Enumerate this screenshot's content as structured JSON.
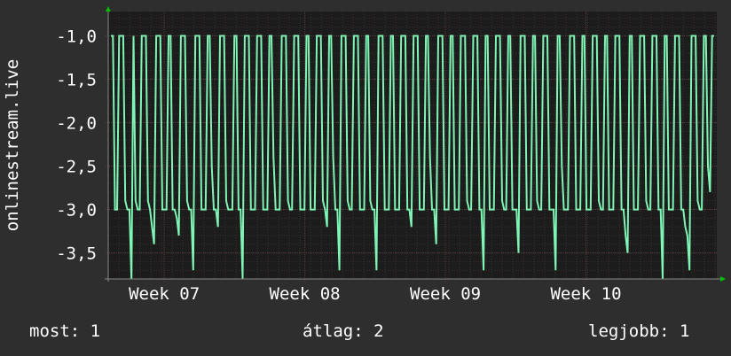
{
  "chart_data": {
    "type": "line",
    "ylabel": "onlinestream.live",
    "yticks": [
      "-1,0",
      "-1,5",
      "-2,0",
      "-2,5",
      "-3,0",
      "-3,5"
    ],
    "ytick_values": [
      -1.0,
      -1.5,
      -2.0,
      -2.5,
      -3.0,
      -3.5
    ],
    "ylim": [
      -3.8,
      -0.72
    ],
    "xlim": [
      0,
      1
    ],
    "xticks": [
      {
        "label": "Week 07",
        "pos": 0.092
      },
      {
        "label": "Week 08",
        "pos": 0.323
      },
      {
        "label": "Week 09",
        "pos": 0.554
      },
      {
        "label": "Week 10",
        "pos": 0.785
      }
    ],
    "grid": true,
    "colors": {
      "background": "#2e2e2e",
      "plot": "#1c1c1c",
      "grid": "#5a3a3a",
      "line": "#7ff5b5",
      "axis_arrow": "#00c000"
    },
    "series": [
      {
        "values": [
          -1.0,
          -1.0,
          -3.0,
          -3.0,
          -1.0,
          -1.0,
          -1.0,
          -2.9,
          -3.0,
          -3.0,
          -3.8,
          -1.0,
          -2.9,
          -3.0,
          -3.0,
          -1.0,
          -1.0,
          -1.0,
          -2.9,
          -3.0,
          -3.2,
          -3.4,
          -1.0,
          -1.0,
          -1.0,
          -3.0,
          -3.0,
          -3.0,
          -1.0,
          -1.0,
          -3.0,
          -3.0,
          -3.1,
          -3.3,
          -1.0,
          -1.0,
          -1.0,
          -2.9,
          -3.0,
          -3.0,
          -3.7,
          -1.0,
          -1.0,
          -1.0,
          -3.0,
          -3.0,
          -3.0,
          -1.0,
          -1.0,
          -2.5,
          -3.0,
          -3.0,
          -3.2,
          -1.0,
          -1.0,
          -1.0,
          -2.9,
          -3.0,
          -3.0,
          -3.0,
          -1.0,
          -1.0,
          -3.0,
          -3.0,
          -3.8,
          -1.0,
          -1.0,
          -1.0,
          -3.0,
          -3.0,
          -3.0,
          -1.0,
          -1.0,
          -1.0,
          -3.0,
          -3.0,
          -3.0,
          -1.0,
          -1.0,
          -2.4,
          -3.0,
          -3.0,
          -3.0,
          -1.0,
          -1.0,
          -1.0,
          -2.9,
          -3.0,
          -3.0,
          -1.0,
          -1.0,
          -1.0,
          -3.0,
          -3.0,
          -3.0,
          -1.0,
          -1.0,
          -3.0,
          -3.0,
          -3.0,
          -1.0,
          -1.0,
          -1.0,
          -2.9,
          -3.0,
          -3.2,
          -1.0,
          -1.0,
          -2.4,
          -3.0,
          -3.0,
          -3.7,
          -1.0,
          -1.0,
          -1.0,
          -2.9,
          -3.0,
          -3.0,
          -1.0,
          -1.0,
          -1.0,
          -3.0,
          -3.0,
          -3.0,
          -1.0,
          -1.0,
          -2.9,
          -3.0,
          -3.0,
          -3.7,
          -1.0,
          -1.0,
          -1.0,
          -3.0,
          -3.0,
          -3.0,
          -1.0,
          -1.0,
          -3.0,
          -3.0,
          -3.0,
          -1.0,
          -1.0,
          -1.0,
          -3.0,
          -3.0,
          -3.2,
          -1.0,
          -1.0,
          -1.0,
          -3.0,
          -3.0,
          -3.0,
          -1.0,
          -1.0,
          -2.4,
          -3.0,
          -3.0,
          -3.4,
          -1.0,
          -1.0,
          -1.0,
          -3.0,
          -3.0,
          -3.0,
          -1.0,
          -1.0,
          -3.0,
          -3.0,
          -3.0,
          -1.0,
          -1.0,
          -1.0,
          -2.9,
          -3.0,
          -3.0,
          -1.0,
          -1.0,
          -1.0,
          -3.0,
          -3.0,
          -3.7,
          -1.0,
          -1.0,
          -3.0,
          -3.0,
          -3.0,
          -1.0,
          -1.0,
          -1.0,
          -2.9,
          -3.0,
          -3.0,
          -1.0,
          -1.0,
          -3.0,
          -3.0,
          -3.0,
          -3.5,
          -1.0,
          -1.0,
          -1.0,
          -3.0,
          -3.0,
          -3.0,
          -1.0,
          -1.0,
          -2.9,
          -3.0,
          -3.0,
          -1.0,
          -1.0,
          -1.0,
          -3.0,
          -3.0,
          -3.0,
          -3.7,
          -1.0,
          -1.0,
          -2.5,
          -3.0,
          -3.0,
          -3.0,
          -1.0,
          -1.0,
          -1.0,
          -3.0,
          -3.0,
          -3.0,
          -1.0,
          -1.0,
          -3.0,
          -3.0,
          -3.0,
          -1.0,
          -1.0,
          -1.0,
          -2.9,
          -3.0,
          -3.0,
          -1.0,
          -1.0,
          -3.0,
          -3.0,
          -3.0,
          -1.0,
          -1.0,
          -1.0,
          -3.0,
          -3.0,
          -3.3,
          -3.5,
          -1.0,
          -1.0,
          -3.0,
          -3.0,
          -3.0,
          -1.0,
          -1.0,
          -1.0,
          -2.9,
          -3.0,
          -3.0,
          -1.0,
          -1.0,
          -1.0,
          -3.0,
          -3.0,
          -3.8,
          -1.0,
          -1.0,
          -3.0,
          -3.0,
          -3.0,
          -1.0,
          -1.0,
          -1.0,
          -3.0,
          -3.0,
          -3.2,
          -3.3,
          -3.7,
          -1.0,
          -1.0,
          -1.0,
          -2.9,
          -3.0,
          -3.0,
          -1.0,
          -1.0,
          -2.5,
          -2.8,
          -1.0,
          -1.0
        ]
      }
    ]
  },
  "footer": {
    "current_label": "most:",
    "current_value": "1",
    "average_label": "átlag:",
    "average_value": "2",
    "best_label": "legjobb:",
    "best_value": "1"
  }
}
